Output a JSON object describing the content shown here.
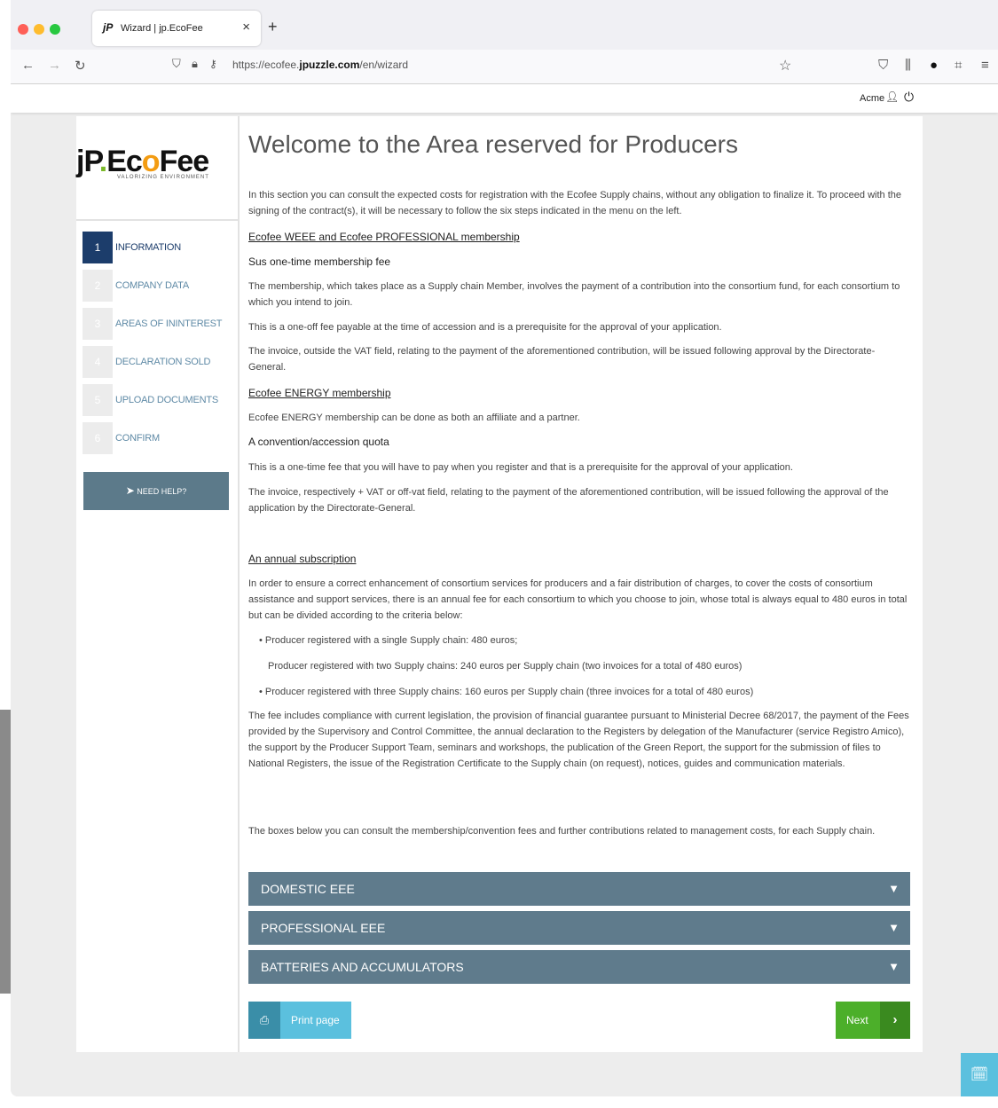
{
  "browser": {
    "tab_title": "Wizard | jp.EcoFee",
    "tab_favicon": "jP",
    "tab_close": "×",
    "new_tab": "+",
    "url_prefix": "https://ecofee.",
    "url_domain": "jpuzzle.com",
    "url_path": "/en/wizard"
  },
  "header": {
    "user_name": "Acme"
  },
  "sidebar": {
    "logo_text_jp": "jP",
    "logo_dot": ".",
    "logo_ec": "Ec",
    "logo_o": "o",
    "logo_fee": "Fee",
    "logo_tagline": "VALORIZING ENVIRONMENT",
    "steps": [
      {
        "number": "1",
        "label": "INFORMATION"
      },
      {
        "number": "2",
        "label": "COMPANY DATA"
      },
      {
        "number": "3",
        "label": "AREAS OF ININTEREST"
      },
      {
        "number": "4",
        "label": "DECLARATION SOLD"
      },
      {
        "number": "5",
        "label": "UPLOAD DOCUMENTS"
      },
      {
        "number": "6",
        "label": "CONFIRM"
      }
    ],
    "help_label": "NEED HELP?"
  },
  "main": {
    "title": "Welcome to the Area reserved for Producers",
    "intro": "In this section you can consult the expected costs for registration with the Ecofee Supply chains, without any obligation to finalize it. To proceed with the signing of the contract(s), it will be necessary to follow the six steps indicated in the menu on the left.",
    "weee_heading": "Ecofee WEEE and Ecofee PROFESSIONAL membership",
    "weee_sub": "Sus one-time membership fee",
    "weee_p1": "The membership, which takes place as a Supply chain Member, involves the payment of a contribution into the consortium fund, for each consortium to which you intend to join.",
    "weee_p2": "This is a one-off fee payable at the time of accession and is a prerequisite for the approval of your application.",
    "weee_p3": "The invoice, outside the VAT field, relating to the payment of the aforementioned contribution, will be issued following approval by the Directorate-General.",
    "energy_heading": "Ecofee ENERGY membership",
    "energy_p1": "Ecofee ENERGY membership can be done as both an affiliate and a partner.",
    "energy_sub": "A convention/accession quota",
    "energy_p2": "This is a one-time fee that you will have to pay when you register and that is a prerequisite for the approval of your application.",
    "energy_p3": "The invoice, respectively + VAT or off-vat field, relating to the payment of the aforementioned contribution, will be issued following the approval of the application by the Directorate-General.",
    "annual_heading": "An annual subscription",
    "annual_p1": "In order to ensure a correct enhancement of consortium services for producers and a fair distribution of charges, to cover the costs of consortium assistance and support services, there is an annual fee for each consortium to which you choose to join, whose total is always equal to 480 euros in total but can be divided according to the criteria below:",
    "bullet1": "Producer registered with a single Supply chain: 480 euros;",
    "bullet2": "Producer registered with two Supply chains: 240 euros per Supply chain (two invoices for a total of 480 euros)",
    "bullet3": "Producer registered with three Supply chains: 160 euros per Supply chain (three invoices for a total of 480 euros)",
    "fee_p": "The fee includes compliance with current legislation, the provision of financial guarantee pursuant to Ministerial Decree 68/2017, the payment of the Fees provided by the Supervisory and Control Committee, the annual declaration to the Registers by delegation of the Manufacturer (service Registro Amico), the support by the Producer Support Team, seminars and workshops, the publication of the Green Report, the support for the submission of files to National Registers, the issue of the Registration Certificate to the Supply chain (on request), notices, guides and communication materials.",
    "boxes_p": "The boxes below you can consult the membership/convention fees and further contributions related to management costs, for each Supply chain.",
    "accordions": [
      {
        "label": "DOMESTIC EEE"
      },
      {
        "label": "PROFESSIONAL EEE"
      },
      {
        "label": "BATTERIES AND ACCUMULATORS"
      }
    ],
    "print_label": "Print page",
    "next_label": "Next"
  },
  "colors": {
    "accent_navy": "#1c3d6b",
    "accordion": "#5f7b8c",
    "print": "#5bc0de",
    "next": "#4caf2a"
  }
}
